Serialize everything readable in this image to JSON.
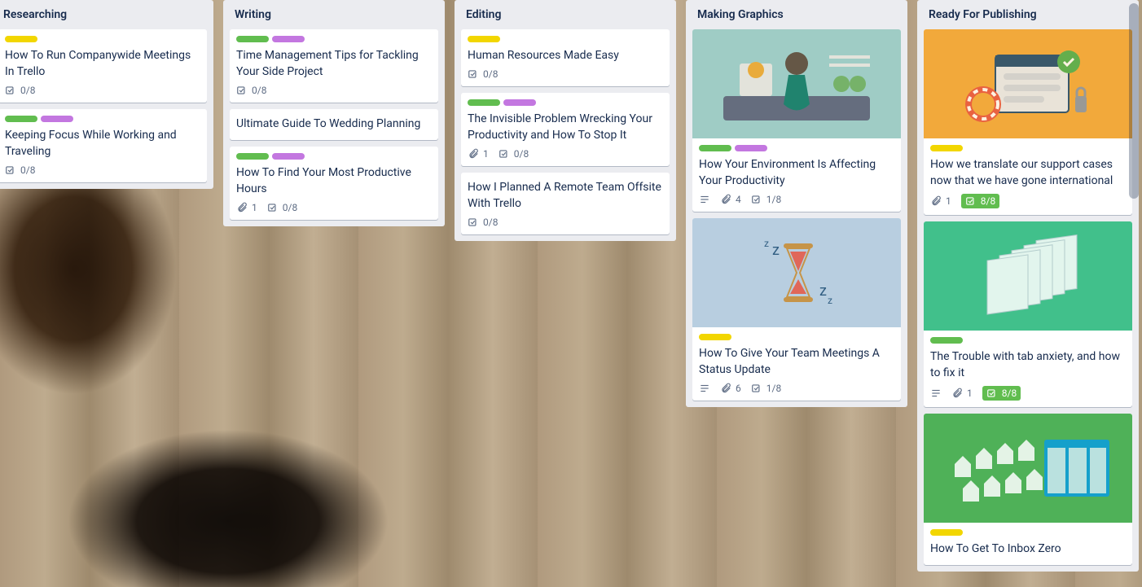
{
  "lists": [
    {
      "title": "Researching",
      "cards": [
        {
          "labels": [
            "yellow"
          ],
          "title": "How To Run Companywide Meetings In Trello",
          "checklist": "0/8"
        },
        {
          "labels": [
            "green",
            "purple"
          ],
          "title": "Keeping Focus While Working and Traveling",
          "checklist": "0/8"
        }
      ]
    },
    {
      "title": "Writing",
      "cards": [
        {
          "labels": [
            "green",
            "purple"
          ],
          "title": "Time Management Tips for Tackling Your Side Project",
          "checklist": "0/8"
        },
        {
          "labels": [],
          "title": "Ultimate Guide To Wedding Planning"
        },
        {
          "labels": [
            "green",
            "purple"
          ],
          "title": "How To Find Your Most Productive Hours",
          "attachments": "1",
          "checklist": "0/8"
        }
      ]
    },
    {
      "title": "Editing",
      "cards": [
        {
          "labels": [
            "yellow"
          ],
          "title": "Human Resources Made Easy",
          "checklist": "0/8"
        },
        {
          "labels": [
            "green",
            "purple"
          ],
          "title": "The Invisible Problem Wrecking Your Productivity and How To Stop It",
          "attachments": "1",
          "checklist": "0/8"
        },
        {
          "labels": [],
          "title": "How I Planned A Remote Team Offsite With Trello",
          "checklist": "0/8"
        }
      ]
    },
    {
      "title": "Making Graphics",
      "cards": [
        {
          "cover": "zen",
          "labels": [
            "green",
            "purple"
          ],
          "title": "How Your Environment Is Affecting Your Productivity",
          "description": true,
          "attachments": "4",
          "checklist": "1/8"
        },
        {
          "cover": "glass",
          "labels": [
            "yellow"
          ],
          "title": "How To Give Your Team Meetings A Status Update",
          "description": true,
          "attachments": "6",
          "checklist": "1/8"
        }
      ]
    },
    {
      "title": "Ready For Publishing",
      "cards": [
        {
          "cover": "orange",
          "labels": [
            "yellow"
          ],
          "title": "How we translate our support cases now that we have gone international",
          "attachments": "1",
          "checklist": "8/8",
          "checklist_complete": true
        },
        {
          "cover": "green",
          "labels": [
            "green"
          ],
          "title": "The Trouble with tab anxiety, and how to fix it",
          "description": true,
          "attachments": "1",
          "checklist": "8/8",
          "checklist_complete": true
        },
        {
          "cover": "green2",
          "labels": [
            "yellow"
          ],
          "title": "How To Get To Inbox Zero"
        }
      ]
    }
  ]
}
